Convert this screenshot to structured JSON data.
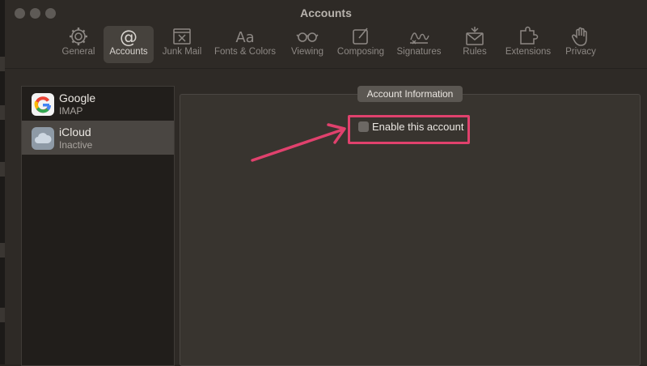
{
  "window": {
    "title": "Accounts"
  },
  "toolbar": {
    "items": [
      {
        "label": "General",
        "icon": "gear-icon"
      },
      {
        "label": "Accounts",
        "icon": "at-icon"
      },
      {
        "label": "Junk Mail",
        "icon": "junk-mail-icon"
      },
      {
        "label": "Fonts & Colors",
        "icon": "font-icon"
      },
      {
        "label": "Viewing",
        "icon": "glasses-icon"
      },
      {
        "label": "Composing",
        "icon": "compose-icon"
      },
      {
        "label": "Signatures",
        "icon": "signature-icon"
      },
      {
        "label": "Rules",
        "icon": "rules-envelope-icon"
      },
      {
        "label": "Extensions",
        "icon": "puzzle-icon"
      },
      {
        "label": "Privacy",
        "icon": "hand-icon"
      }
    ],
    "selected": "Accounts"
  },
  "accounts": [
    {
      "name": "Google",
      "subtitle": "IMAP",
      "icon": "google-logo-icon",
      "selected": false
    },
    {
      "name": "iCloud",
      "subtitle": "Inactive",
      "icon": "icloud-icon",
      "selected": true
    }
  ],
  "info_panel": {
    "tab_label": "Account Information",
    "enable_checkbox": {
      "label": "Enable this account",
      "checked": false
    }
  },
  "annotation": {
    "color": "#e0416d"
  }
}
